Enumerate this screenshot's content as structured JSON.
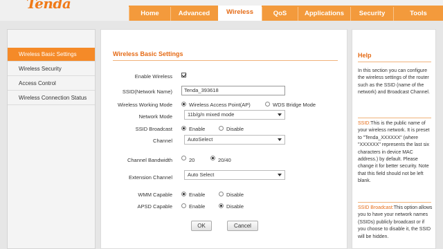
{
  "header": {
    "logo": "Tenda",
    "tabs": [
      {
        "label": "Home"
      },
      {
        "label": "Advanced"
      },
      {
        "label": "Wireless",
        "active": true
      },
      {
        "label": "QoS"
      },
      {
        "label": "Applications"
      },
      {
        "label": "Security"
      },
      {
        "label": "Tools"
      }
    ]
  },
  "sidebar": {
    "items": [
      {
        "label": "Wireless Basic Settings",
        "active": true
      },
      {
        "label": "Wireless Security"
      },
      {
        "label": "Access Control"
      },
      {
        "label": "Wireless Connection Status"
      }
    ]
  },
  "form": {
    "title": "Wireless Basic Settings",
    "enable_wireless": {
      "label": "Enable Wireless",
      "checked": true
    },
    "ssid": {
      "label": "SSID(Network Name)",
      "value": "Tenda_393618"
    },
    "working_mode": {
      "label": "Wireless Working Mode",
      "options": [
        "Wireless Access Point(AP)",
        "WDS Bridge Mode"
      ],
      "selected": "Wireless Access Point(AP)"
    },
    "network_mode": {
      "label": "Network Mode",
      "value": "11b/g/n mixed mode"
    },
    "ssid_broadcast": {
      "label": "SSID Broadcast",
      "options": [
        "Enable",
        "Disable"
      ],
      "selected": "Enable"
    },
    "channel": {
      "label": "Channel",
      "value": "AutoSelect"
    },
    "channel_bandwidth": {
      "label": "Channel Bandwidth",
      "options": [
        "20",
        "20/40"
      ],
      "selected": "20/40"
    },
    "extension_channel": {
      "label": "Extension Channel",
      "value": "Auto Select"
    },
    "wmm": {
      "label": "WMM Capable",
      "options": [
        "Enable",
        "Disable"
      ],
      "selected": "Enable"
    },
    "apsd": {
      "label": "APSD Capable",
      "options": [
        "Enable",
        "Disable"
      ],
      "selected": "Disable"
    },
    "ok_label": "OK",
    "cancel_label": "Cancel"
  },
  "help": {
    "title": "Help",
    "intro": "In this section you can configure the wireless settings of the router such as the SSID (name of the network) and Broadcast Channel.",
    "ssid_term": "SSID:",
    "ssid_text": "This is the public name of your wireless network. It is preset to \"Tenda_XXXXXX\" (where \"XXXXXX\" represents the last six characters in device MAC address.) by default. Please change it for better security. Note that this field should not be left blank.",
    "broadcast_term": "SSID Broadcast:",
    "broadcast_text": "This option allows you to have your network names (SSIDs) publicly broadcast or if you choose to disable it, the SSID will be hidden."
  },
  "colors": {
    "accent": "#f39a3c",
    "title_orange": "#e56b16",
    "sidebar_active": "#f58a28"
  }
}
